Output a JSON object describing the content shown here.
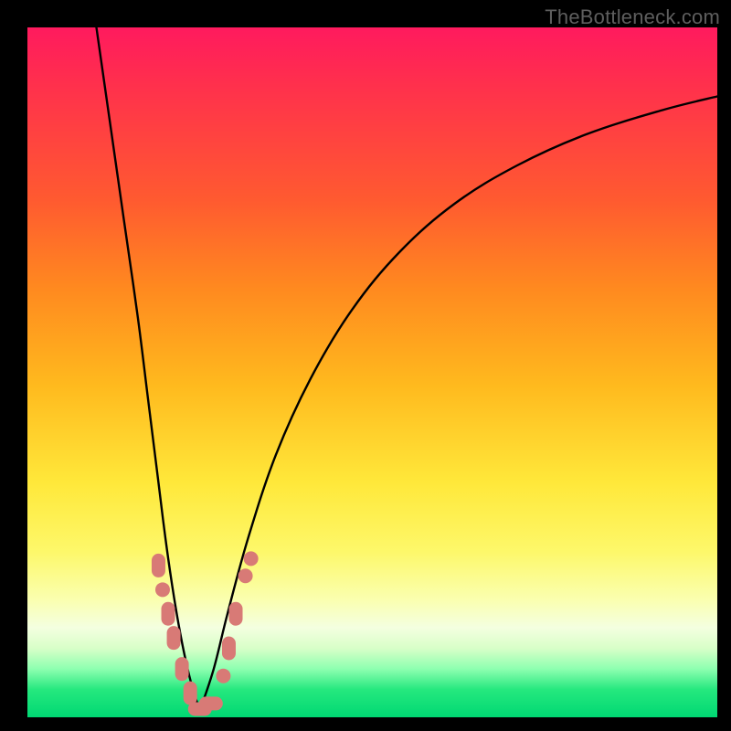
{
  "watermark": "TheBottleneck.com",
  "colors": {
    "frame": "#000000",
    "curve_stroke": "#000000",
    "marker_fill": "#d87a76",
    "marker_stroke": "#b35a58"
  },
  "chart_data": {
    "type": "line",
    "title": "",
    "xlabel": "",
    "ylabel": "",
    "xlim": [
      0,
      100
    ],
    "ylim": [
      0,
      100
    ],
    "note": "Axes have no tick labels; values are relative percentages of plot area. y=0 is bottom (green), y=100 is top (red).",
    "series": [
      {
        "name": "left-branch",
        "x": [
          10.0,
          12.0,
          14.0,
          16.0,
          17.5,
          19.0,
          20.0,
          21.0,
          22.0,
          23.0,
          24.0,
          25.0
        ],
        "y": [
          100.0,
          86.0,
          72.0,
          58.0,
          46.0,
          34.0,
          26.0,
          19.0,
          13.0,
          8.0,
          4.0,
          1.0
        ]
      },
      {
        "name": "right-branch",
        "x": [
          25.0,
          27.0,
          29.0,
          32.0,
          36.0,
          41.0,
          47.0,
          54.0,
          62.0,
          71.0,
          81.0,
          92.0,
          100.0
        ],
        "y": [
          1.0,
          7.0,
          15.0,
          26.0,
          38.0,
          49.0,
          59.0,
          67.5,
          74.5,
          80.0,
          84.5,
          88.0,
          90.0
        ]
      }
    ],
    "markers": [
      {
        "x": 19.0,
        "y": 22.0,
        "shape": "pill-v"
      },
      {
        "x": 19.6,
        "y": 18.5,
        "shape": "dot"
      },
      {
        "x": 20.4,
        "y": 15.0,
        "shape": "pill-v"
      },
      {
        "x": 21.2,
        "y": 11.5,
        "shape": "pill-v"
      },
      {
        "x": 22.4,
        "y": 7.0,
        "shape": "pill-v"
      },
      {
        "x": 23.6,
        "y": 3.5,
        "shape": "pill-v"
      },
      {
        "x": 25.0,
        "y": 1.2,
        "shape": "pill-h"
      },
      {
        "x": 26.6,
        "y": 2.0,
        "shape": "pill-h"
      },
      {
        "x": 28.4,
        "y": 6.0,
        "shape": "dot"
      },
      {
        "x": 29.2,
        "y": 10.0,
        "shape": "pill-v"
      },
      {
        "x": 30.2,
        "y": 15.0,
        "shape": "pill-v"
      },
      {
        "x": 31.6,
        "y": 20.5,
        "shape": "dot"
      },
      {
        "x": 32.4,
        "y": 23.0,
        "shape": "dot"
      }
    ]
  }
}
